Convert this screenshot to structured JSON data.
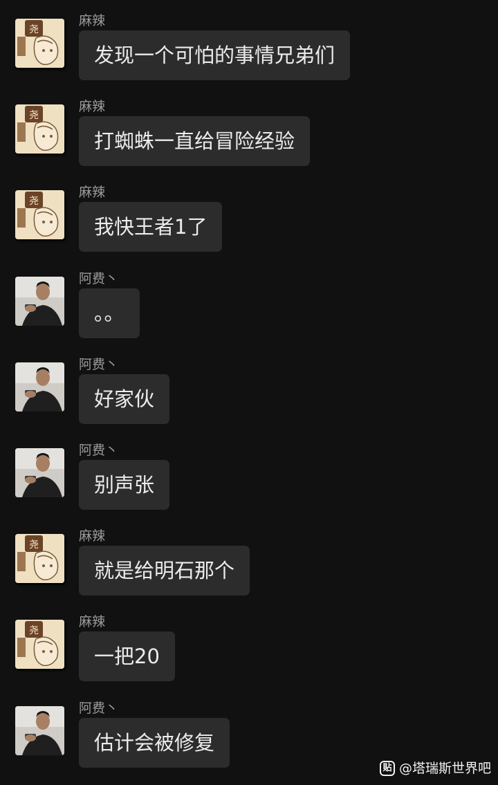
{
  "messages": [
    {
      "sender": "麻辣",
      "avatar": "anime-girl-avatar",
      "text": "发现一个可怕的事情兄弟们"
    },
    {
      "sender": "麻辣",
      "avatar": "anime-girl-avatar",
      "text": "打蜘蛛一直给冒险经验"
    },
    {
      "sender": "麻辣",
      "avatar": "anime-girl-avatar",
      "text": "我快王者1了"
    },
    {
      "sender": "阿费丶",
      "avatar": "man-photo-avatar",
      "text": "。。"
    },
    {
      "sender": "阿费丶",
      "avatar": "man-photo-avatar",
      "text": "好家伙"
    },
    {
      "sender": "阿费丶",
      "avatar": "man-photo-avatar",
      "text": "别声张"
    },
    {
      "sender": "麻辣",
      "avatar": "anime-girl-avatar",
      "text": "就是给明石那个"
    },
    {
      "sender": "麻辣",
      "avatar": "anime-girl-avatar",
      "text": "一把20"
    },
    {
      "sender": "阿费丶",
      "avatar": "man-photo-avatar",
      "text": "估计会被修复"
    }
  ],
  "watermark": {
    "icon": "贴",
    "text": "@塔瑞斯世界吧"
  },
  "colors": {
    "background": "#111111",
    "bubble": "#2c2c2c",
    "sender_name": "#9b9b9b",
    "message_text": "#ececec"
  }
}
